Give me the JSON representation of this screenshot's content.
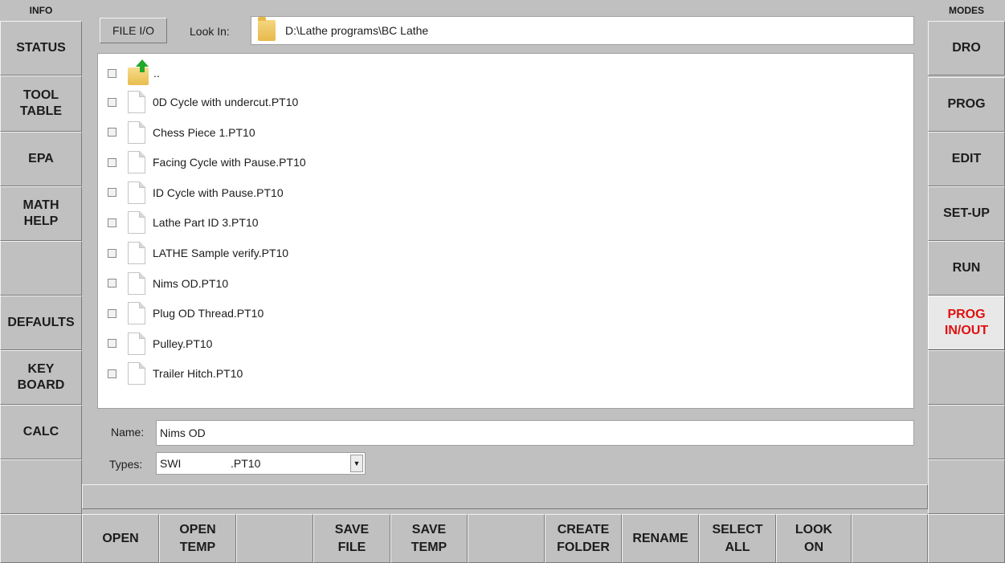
{
  "left_panel": {
    "header": "INFO",
    "buttons": [
      "STATUS",
      "TOOL\nTABLE",
      "EPA",
      "MATH\nHELP",
      "",
      "DEFAULTS",
      "KEY\nBOARD",
      "CALC",
      ""
    ]
  },
  "right_panel": {
    "header": "MODES",
    "buttons": [
      "DRO",
      "PROG",
      "EDIT",
      "SET-UP",
      "RUN",
      "PROG\nIN/OUT",
      "",
      "",
      ""
    ],
    "active_index": 5,
    "active_color": "#e01010"
  },
  "file_io": {
    "tab_label": "FILE I/O",
    "look_in_label": "Look In:",
    "look_in_path": "D:\\Lathe programs\\BC Lathe",
    "parent_dir": "..",
    "files": [
      "0D Cycle with undercut.PT10",
      "Chess Piece 1.PT10",
      "Facing Cycle with Pause.PT10",
      "ID Cycle with Pause.PT10",
      "Lathe Part ID 3.PT10",
      "LATHE Sample verify.PT10",
      "Nims OD.PT10",
      "Plug OD Thread.PT10",
      "Pulley.PT10",
      "Trailer Hitch.PT10"
    ],
    "name_label": "Name:",
    "name_value": "Nims OD",
    "types_label": "Types:",
    "types_value_a": "SWI",
    "types_value_b": ".PT10"
  },
  "toolbar": {
    "buttons": [
      "",
      "OPEN",
      "OPEN\nTEMP",
      "",
      "SAVE\nFILE",
      "SAVE\nTEMP",
      "",
      "CREATE\nFOLDER",
      "RENAME",
      "SELECT\nALL",
      "LOOK\nON",
      "",
      ""
    ]
  }
}
